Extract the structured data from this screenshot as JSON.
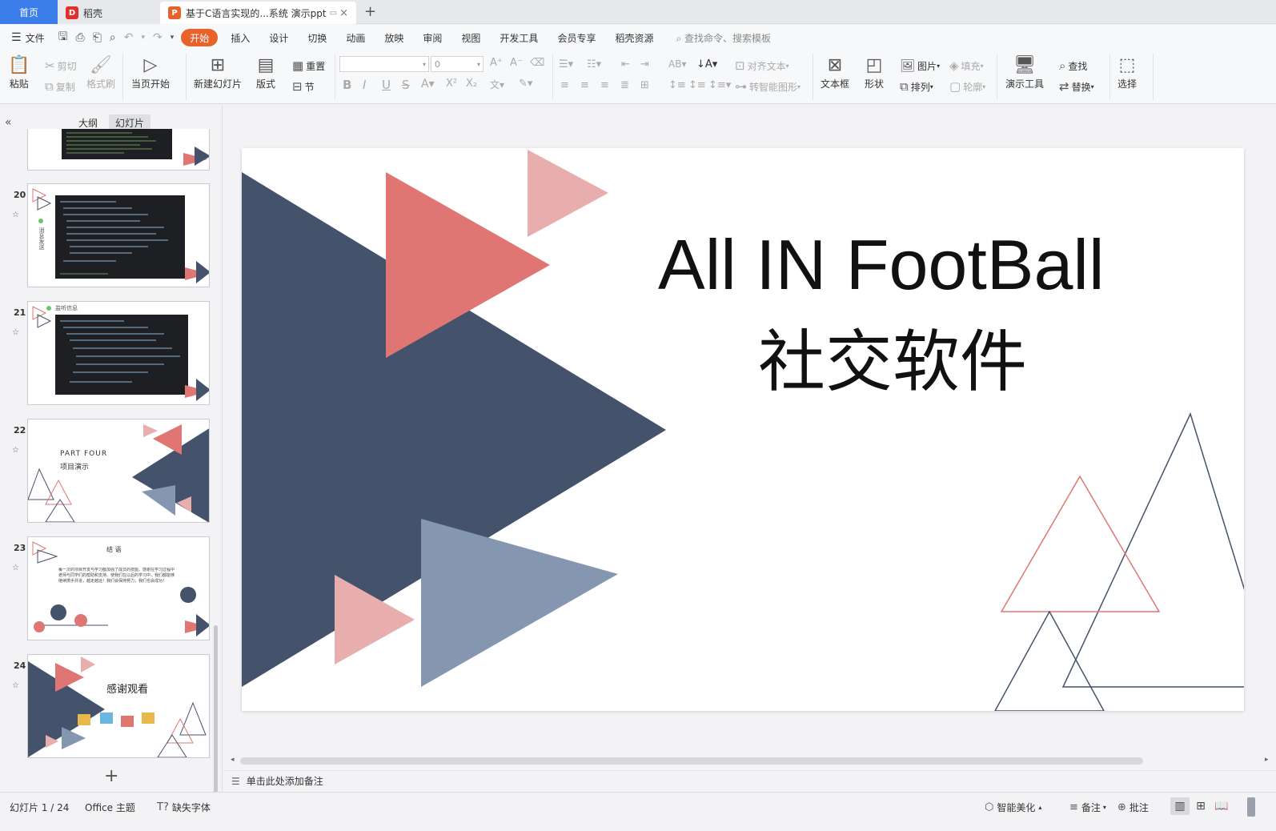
{
  "tabs": {
    "home": "首页",
    "daoke": "稻壳",
    "doc": "基于C语言实现的...系统 演示ppt",
    "add": "+",
    "close": "×"
  },
  "menu": {
    "file": "文件",
    "items": [
      "开始",
      "插入",
      "设计",
      "切换",
      "动画",
      "放映",
      "审阅",
      "视图",
      "开发工具",
      "会员专享",
      "稻壳资源"
    ],
    "search": "查找命令、搜索模板"
  },
  "ribbon": {
    "paste": "粘贴",
    "cut": "剪切",
    "copy": "复制",
    "format_painter": "格式刷",
    "start_from_current": "当页开始",
    "new_slide": "新建幻灯片",
    "layout": "版式",
    "reset": "重置",
    "section": "节",
    "font_size": "0",
    "align_text": "对齐文本",
    "smart_art": "转智能图形",
    "text_box": "文本框",
    "shape": "形状",
    "picture": "图片",
    "arrange": "排列",
    "fill": "填充",
    "outline": "轮廓",
    "presentation_tools": "演示工具",
    "find": "查找",
    "replace": "替换",
    "select": "选择"
  },
  "left_panel": {
    "outline_tab": "大纲",
    "slides_tab": "幻灯片",
    "collapse": "«",
    "add": "+",
    "slides": [
      {
        "num": "20",
        "label": "消息发送"
      },
      {
        "num": "21",
        "label": "监听信息"
      },
      {
        "num": "22",
        "part": "PART FOUR",
        "label": "项目演示"
      },
      {
        "num": "23",
        "label": "结 语",
        "body": "每一次的项目开发与学习都加强了成员的技能。感谢在学习过程中老师与同学们的帮助和支持。使我们在以后的学习中，我们都能够继续携手并进，越走越远！我们会保持努力，我们也会成功！"
      },
      {
        "num": "24",
        "label": "感谢观看"
      }
    ]
  },
  "slide": {
    "title_en": "All IN FootBall",
    "title_cn": "社交软件"
  },
  "notes": {
    "placeholder": "单击此处添加备注"
  },
  "status": {
    "slide_counter": "幻灯片 1 / 24",
    "theme": "Office 主题",
    "missing_font": "缺失字体",
    "smart_beautify": "智能美化",
    "notes": "备注",
    "comments": "批注"
  },
  "colors": {
    "accent_orange": "#e8622b",
    "home_tab_blue": "#3b7de9",
    "navy": "#44536b",
    "coral": "#e07674",
    "pink": "#e8adad",
    "steel": "#8496b0"
  }
}
